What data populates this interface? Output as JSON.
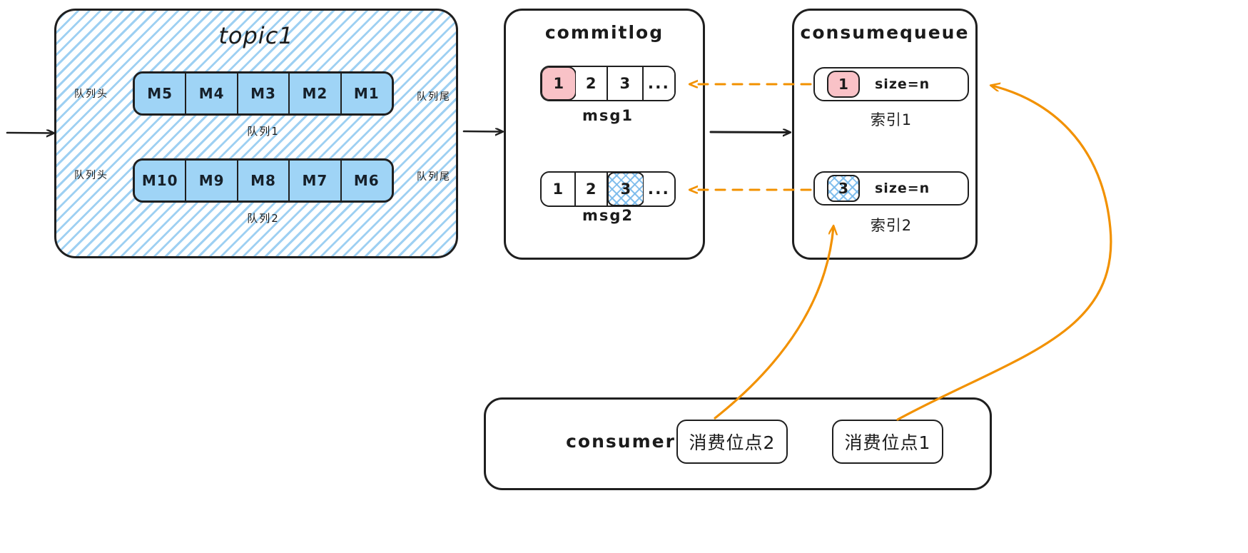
{
  "diagram": {
    "title": "RocketMQ topic / commitlog / consumequeue / consumer",
    "colors": {
      "ink": "#1f1f1f",
      "queue_cell_blue": "#9fd4f6",
      "hatch_blue": "#8dc8f0",
      "highlight_pink": "#f9c2c7",
      "arrow_orange": "#f29100",
      "paper": "#ffffff"
    }
  },
  "topic": {
    "title": "topic1",
    "queues": [
      {
        "name": "队列1",
        "head_label": "队列头",
        "tail_label": "队列尾",
        "cells": [
          "M5",
          "M4",
          "M3",
          "M2",
          "M1"
        ]
      },
      {
        "name": "队列2",
        "head_label": "队列头",
        "tail_label": "队列尾",
        "cells": [
          "M10",
          "M9",
          "M8",
          "M7",
          "M6"
        ]
      }
    ]
  },
  "commitlog": {
    "title": "commitlog",
    "messages": [
      {
        "name": "msg1",
        "cells": [
          "1",
          "2",
          "3",
          "..."
        ],
        "highlight_index": 0,
        "highlight_style": "pink"
      },
      {
        "name": "msg2",
        "cells": [
          "1",
          "2",
          "3",
          "..."
        ],
        "highlight_index": 2,
        "highlight_style": "hatch"
      }
    ]
  },
  "consumequeue": {
    "title": "consumequeue",
    "rows": [
      {
        "chip": "1",
        "size_label": "size=n",
        "index_label": "索引1",
        "chip_style": "pink"
      },
      {
        "chip": "3",
        "size_label": "size=n",
        "index_label": "索引2",
        "chip_style": "hatch"
      }
    ]
  },
  "consumer": {
    "title": "consumer",
    "offsets": [
      {
        "label": "消费位点2"
      },
      {
        "label": "消费位点1"
      }
    ]
  },
  "connectors": [
    {
      "name": "producer-in-arrow",
      "style": "solid-black",
      "from": "left-edge",
      "to": "topic1"
    },
    {
      "name": "topic-to-commitlog-arrow",
      "style": "solid-black",
      "from": "topic1",
      "to": "commitlog"
    },
    {
      "name": "commitlog-to-cq-arrow",
      "style": "solid-black",
      "from": "commitlog",
      "to": "consumequeue"
    },
    {
      "name": "cq1-to-msg1-dashed",
      "style": "dashed-orange",
      "from": "索引1",
      "to": "msg1"
    },
    {
      "name": "cq2-to-msg2-dashed",
      "style": "dashed-orange",
      "from": "索引2",
      "to": "msg2"
    },
    {
      "name": "offset2-to-cq2-curve",
      "style": "curve-orange",
      "from": "消费位点2",
      "to": "索引2"
    },
    {
      "name": "offset1-to-cq1-curve",
      "style": "curve-orange",
      "from": "消费位点1",
      "to": "索引1"
    }
  ]
}
